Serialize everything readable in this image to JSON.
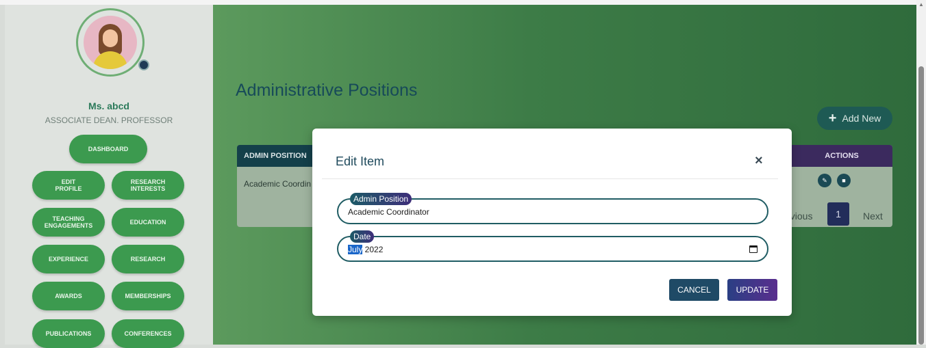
{
  "profile": {
    "name": "Ms. abcd",
    "role": "ASSOCIATE DEAN. PROFESSOR"
  },
  "nav": {
    "dashboard": "DASHBOARD",
    "edit_profile": "EDIT PROFILE",
    "research_interests": "RESEARCH INTERESTS",
    "teaching_engagements": "TEACHING ENGAGEMENTS",
    "education": "EDUCATION",
    "experience": "EXPERIENCE",
    "research": "RESEARCH",
    "awards": "AWARDS",
    "memberships": "MEMBERSHIPS",
    "publications": "PUBLICATIONS",
    "conferences": "CONFERENCES"
  },
  "page": {
    "title": "Administrative Positions",
    "add_new_label": "Add New"
  },
  "table": {
    "columns": {
      "admin_position": "ADMIN POSITION",
      "actions": "ACTIONS"
    },
    "rows": [
      {
        "admin_position": "Academic Coordin"
      }
    ]
  },
  "pagination": {
    "previous": "evious",
    "current_page": "1",
    "next": "Next"
  },
  "modal": {
    "title": "Edit Item",
    "close_glyph": "×",
    "fields": {
      "admin_position": {
        "label": "Admin Position",
        "value": "Academic Coordinator"
      },
      "date": {
        "label": "Date",
        "month": "July",
        "year": " 2022"
      }
    },
    "cancel_label": "CANCEL",
    "update_label": "UPDATE"
  },
  "icons": {
    "plus": "plus-icon",
    "edit": "edit-icon",
    "delete": "trash-icon",
    "calendar": "calendar-icon",
    "close": "close-icon"
  },
  "colors": {
    "primary_teal": "#1f5c63",
    "accent_purple": "#5a2e8e",
    "nav_green": "#3c9a4f"
  }
}
